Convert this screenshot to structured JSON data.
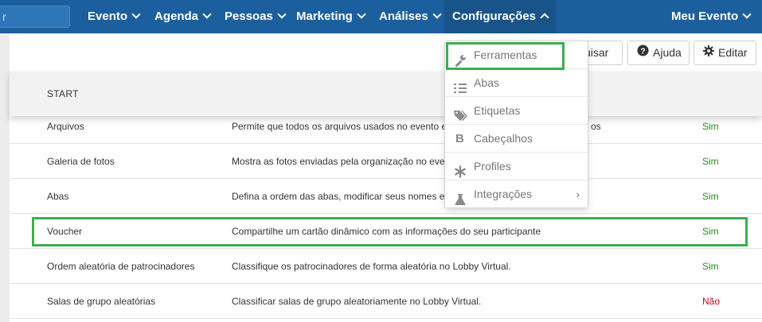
{
  "navbar": {
    "search_text": "r",
    "items": [
      {
        "label": "Evento"
      },
      {
        "label": "Agenda"
      },
      {
        "label": "Pessoas"
      },
      {
        "label": "Marketing"
      },
      {
        "label": "Análises"
      },
      {
        "label": "Configurações"
      }
    ],
    "right_label": "Meu Evento"
  },
  "toolbar": {
    "search_label": "uisar",
    "help_label": "Ajuda",
    "edit_label": "Editar"
  },
  "table": {
    "header": "START",
    "rows": [
      {
        "name": "Arquivos",
        "description": "Permite que todos os arquivos usados no evento e",
        "description_tail": "os",
        "status": "Sim"
      },
      {
        "name": "Galeria de fotos",
        "description": "Mostra as fotos enviadas pela organização no even",
        "status": "Sim"
      },
      {
        "name": "Abas",
        "description": "Defina a ordem das abas, modificar seus nomes e c",
        "status": "Sim"
      },
      {
        "name": "Voucher",
        "description": "Compartilhe um cartão dinâmico com as informações do seu participante",
        "status": "Sim"
      },
      {
        "name": "Ordem aleatória de patrocinadores",
        "description": "Classifique os patrocinadores de forma aleatória no Lobby Virtual.",
        "status": "Sim"
      },
      {
        "name": "Salas de grupo aleatórias",
        "description": "Classificar salas de grupo aleatoriamente no Lobby Virtual.",
        "status": "Não"
      }
    ]
  },
  "dropdown": {
    "items": [
      {
        "label": "Ferramentas",
        "icon": "wrench-icon"
      },
      {
        "label": "Abas",
        "icon": "list-check-icon"
      },
      {
        "label": "Etiquetas",
        "icon": "tags-icon"
      },
      {
        "label": "Cabeçalhos",
        "icon": "bold-icon"
      },
      {
        "label": "Profiles",
        "icon": "asterisk-icon"
      },
      {
        "label": "Integrações",
        "icon": "flask-icon"
      }
    ]
  },
  "colors": {
    "navbar": "#1c5f9e",
    "highlight": "#3cae4f",
    "yes": "#2e8b22",
    "no": "#d0021b"
  }
}
